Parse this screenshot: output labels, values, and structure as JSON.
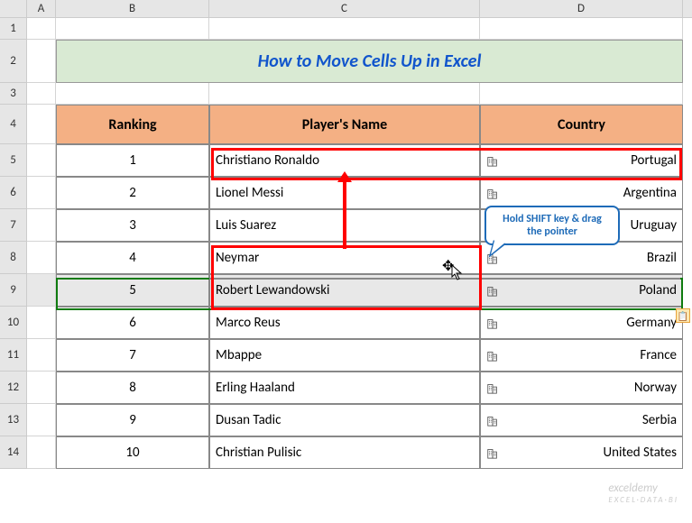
{
  "columns": [
    "A",
    "B",
    "C",
    "D"
  ],
  "title": "How to Move Cells Up in Excel",
  "headers": {
    "ranking": "Ranking",
    "player": "Player's Name",
    "country": "Country"
  },
  "callout": "Hold SHIFT key & drag the pointer",
  "watermark": "exceldemy",
  "watermark_sub": "EXCEL·DATA·BI",
  "rows": [
    {
      "num": "1",
      "rank": "1",
      "player": "Christiano Ronaldo",
      "country": "Portugal"
    },
    {
      "num": "2",
      "rank": "2",
      "player": "Lionel Messi",
      "country": "Argentina"
    },
    {
      "num": "3",
      "rank": "3",
      "player": "Luis Suarez",
      "country": "Uruguay"
    },
    {
      "num": "4",
      "rank": "4",
      "player": "Neymar",
      "country": "Brazil"
    },
    {
      "num": "5",
      "rank": "5",
      "player": "Robert Lewandowski",
      "country": "Poland"
    },
    {
      "num": "6",
      "rank": "6",
      "player": "Marco Reus",
      "country": "Germany"
    },
    {
      "num": "7",
      "rank": "7",
      "player": "Mbappe",
      "country": "France"
    },
    {
      "num": "8",
      "rank": "8",
      "player": "Erling Haaland",
      "country": "Norway"
    },
    {
      "num": "9",
      "rank": "9",
      "player": "Dusan Tadic",
      "country": "Serbia"
    },
    {
      "num": "10",
      "rank": "10",
      "player": "Christian Pulisic",
      "country": "United States"
    }
  ],
  "row_labels": [
    "1",
    "2",
    "3",
    "4",
    "5",
    "6",
    "7",
    "8",
    "9",
    "10",
    "11",
    "12",
    "13",
    "14"
  ]
}
